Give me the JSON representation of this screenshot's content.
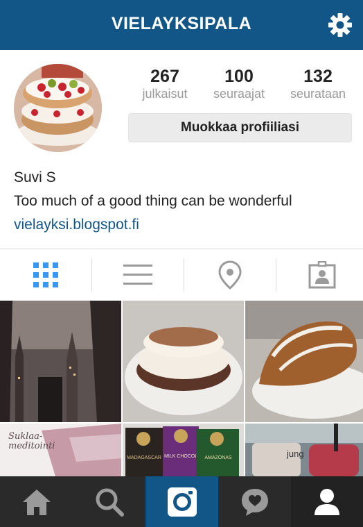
{
  "header": {
    "title": "VIELAYKSIPALA",
    "settings_icon": "gear-icon"
  },
  "profile": {
    "stats": [
      {
        "value": "267",
        "label": "julkaisut"
      },
      {
        "value": "100",
        "label": "seuraajat"
      },
      {
        "value": "132",
        "label": "seurataan"
      }
    ],
    "edit_button": "Muokkaa profiiliasi",
    "name": "Suvi S",
    "bio": "Too much of a good thing can be wonderful",
    "website": "vielayksi.blogspot.fi"
  },
  "view_tabs": [
    {
      "icon": "grid-view-icon",
      "active": true
    },
    {
      "icon": "list-view-icon",
      "active": false
    },
    {
      "icon": "location-pin-icon",
      "active": false
    },
    {
      "icon": "tagged-photos-icon",
      "active": false
    }
  ],
  "posts": {
    "thumbnail_texts": {
      "suklaa": "Suklaa-meditointi",
      "chocolate_1": "MADAGASCAR",
      "chocolate_2": "MILK CHOCOLATE",
      "chocolate_3": "AMAZONAS",
      "cafe": "jung"
    }
  },
  "bottom_nav": [
    {
      "icon": "home-icon"
    },
    {
      "icon": "search-icon"
    },
    {
      "icon": "camera-icon",
      "active": true
    },
    {
      "icon": "activity-heart-icon"
    },
    {
      "icon": "profile-icon"
    }
  ],
  "colors": {
    "brand": "#125688",
    "nav_bg": "#2a2a2a",
    "tab_active": "#3897f0"
  }
}
